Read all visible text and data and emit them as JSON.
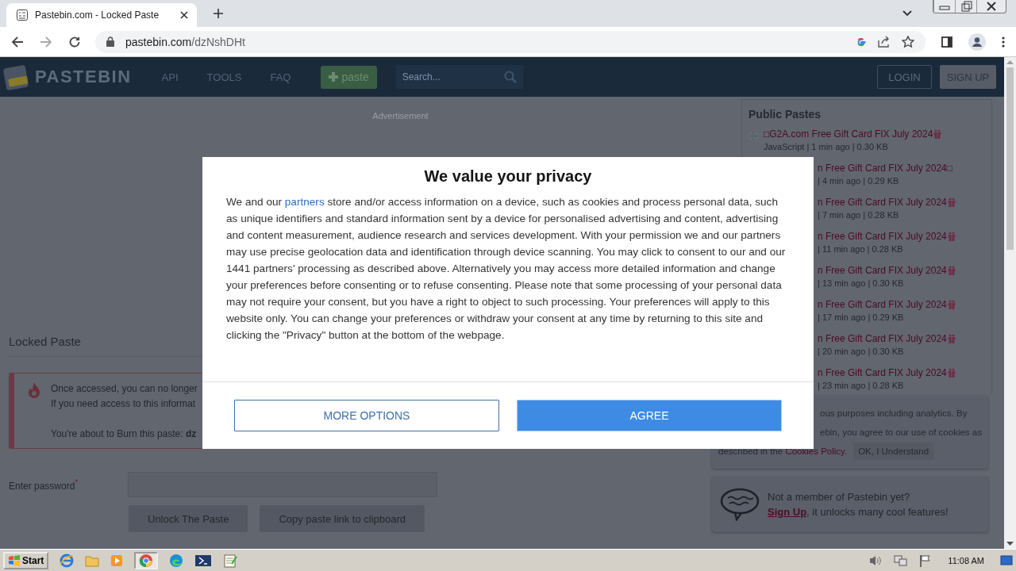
{
  "browser": {
    "tab": {
      "title": "Pastebin.com - Locked Paste"
    },
    "address": {
      "host": "pastebin.com",
      "path": "/dzNshDHt"
    }
  },
  "header": {
    "logo": "PASTEBIN",
    "nav": [
      {
        "label": "API"
      },
      {
        "label": "TOOLS"
      },
      {
        "label": "FAQ"
      }
    ],
    "paste_button": "paste",
    "search": {
      "placeholder": "Search..."
    },
    "login": "LOGIN",
    "signup": "SIGN UP"
  },
  "ad_label": "Advertisement",
  "locked": {
    "title": "Locked Paste",
    "alert_lines": [
      "Once accessed, you can no longer",
      "If you need access to this informat"
    ],
    "burn": "You're about to Burn this paste: **dz**",
    "password_label": "Enter password",
    "required_mark": "*",
    "buttons": [
      "Unlock The Paste",
      "Copy paste link to clipboard"
    ]
  },
  "public_pastes": {
    "title": "Public Pastes",
    "items": [
      {
        "kind": "full",
        "title": "□G2A.com Free Gift Card FIX July 2024",
        "gift": true,
        "meta": "JavaScript | 1 min ago | 0.30 KB"
      },
      {
        "kind": "partial",
        "title": "n Free Gift Card FIX July 2024□",
        "gift": false,
        "meta": "| 4 min ago | 0.29 KB"
      },
      {
        "kind": "partial",
        "title": "n Free Gift Card FIX July 2024",
        "gift": true,
        "meta": "| 7 min ago | 0.28 KB"
      },
      {
        "kind": "partial",
        "title": "n Free Gift Card FIX July 2024",
        "gift": true,
        "meta": "| 11 min ago | 0.28 KB"
      },
      {
        "kind": "partial",
        "title": "n Free Gift Card FIX July 2024",
        "gift": true,
        "meta": "| 13 min ago | 0.30 KB"
      },
      {
        "kind": "partial",
        "title": "n Free Gift Card FIX July 2024",
        "gift": true,
        "meta": "| 17 min ago | 0.29 KB"
      },
      {
        "kind": "partial",
        "title": "n Free Gift Card FIX July 2024",
        "gift": true,
        "meta": "| 20 min ago | 0.30 KB"
      },
      {
        "kind": "partial",
        "title": "n Free Gift Card FIX July 2024",
        "gift": true,
        "meta": "| 23 min ago | 0.28 KB"
      }
    ]
  },
  "cookie_notice": {
    "lines": [
      "ous purposes including analytics. By",
      "ebin, you agree to our use of cookies as"
    ],
    "lead": "described in the",
    "link": "Cookies Policy",
    "tail": ".",
    "button": "OK, I Understand"
  },
  "member_box": {
    "question": "Not a member of Pastebin yet?",
    "link": "Sign Up",
    "rest": ", it unlocks many cool features!"
  },
  "consent": {
    "title": "We value your privacy",
    "before": "We and our ",
    "link": "partners",
    "after": " store and/or access information on a device, such as cookies and process personal data, such as unique identifiers and standard information sent by a device for personalised advertising and content, advertising and content measurement, audience research and services development. With your permission we and our partners may use precise geolocation data and identification through device scanning. You may click to consent to our and our 1441 partners' processing as described above. Alternatively you may access more detailed information and change your preferences before consenting or to refuse consenting. Please note that some processing of your personal data may not require your consent, but you have a right to object to such processing. Your preferences will apply to this website only. You can change your preferences or withdraw your consent at any time by returning to this site and clicking the \"Privacy\" button at the bottom of the webpage.",
    "buttons": [
      {
        "kind": "outline",
        "label": "MORE OPTIONS"
      },
      {
        "kind": "primary",
        "label": "AGREE"
      }
    ]
  },
  "taskbar": {
    "start": "Start",
    "clock": "11:08 AM"
  }
}
